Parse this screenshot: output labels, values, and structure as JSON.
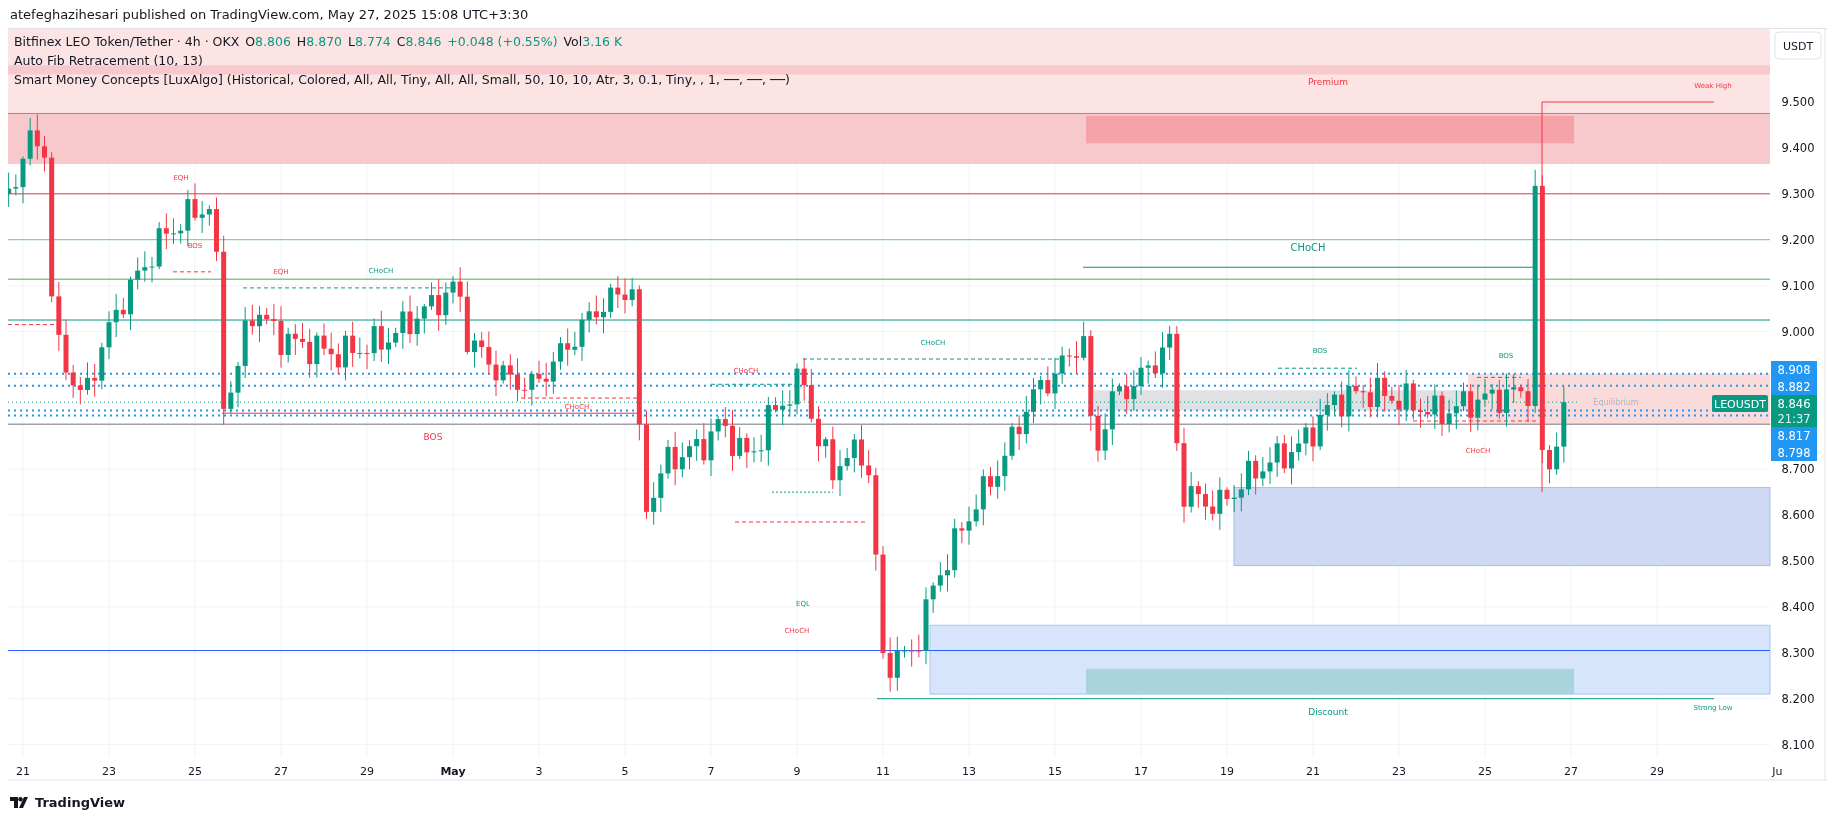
{
  "publisher": "atefeghazihesari published on TradingView.com, May 27, 2025 15:08 UTC+3:30",
  "legend": {
    "symbol": "Bitfinex LEO Token/Tether · 4h · OKX",
    "values": [
      {
        "key": "O",
        "value": "8.806"
      },
      {
        "key": "H",
        "value": "8.870"
      },
      {
        "key": "L",
        "value": "8.774"
      },
      {
        "key": "C",
        "value": "8.846"
      }
    ],
    "change": "+0.048 (+0.55%)",
    "volume_key": "Vol",
    "volume": "3.16 K",
    "indicators": [
      "Auto Fib Retracement (10, 13)",
      "Smart Money Concepts [LuxAlgo] (Historical, Colored, All, All, Tiny, All, All, Small, 50, 10, 10, Atr, 3, 0.1, Tiny, , 1, ──, ──, ──)"
    ]
  },
  "chart_labels": [
    {
      "text": "Premium",
      "kind": "bearish"
    },
    {
      "text": "Weak High",
      "kind": "bearish"
    },
    {
      "text": "EQH",
      "kind": "bearish"
    },
    {
      "text": "BOS",
      "kind": "bearish"
    },
    {
      "text": "EQH",
      "kind": "bearish"
    },
    {
      "text": "CHoCH",
      "kind": "bullish"
    },
    {
      "text": "CHoCH",
      "kind": "bullish"
    },
    {
      "text": "CHoCH",
      "kind": "bullish"
    },
    {
      "text": "BOS",
      "kind": "bullish"
    },
    {
      "text": "BOS",
      "kind": "bullish"
    },
    {
      "text": "CHoCH",
      "kind": "bearish"
    },
    {
      "text": "CHoCH",
      "kind": "bearish"
    },
    {
      "text": "Equilibrium",
      "kind": "neutral"
    },
    {
      "text": "BOS",
      "kind": "bearish"
    },
    {
      "text": "CHoCH",
      "kind": "bearish"
    },
    {
      "text": "EQL",
      "kind": "bullish"
    },
    {
      "text": "CHoCH",
      "kind": "bearish"
    },
    {
      "text": "Discount",
      "kind": "bullish"
    },
    {
      "text": "Strong Low",
      "kind": "bullish"
    }
  ],
  "symbol_tag": "LEOUSDT",
  "price_axis": {
    "unit_button": "USDT",
    "ticks": [
      "9.500",
      "9.400",
      "9.300",
      "9.200",
      "9.100",
      "9.000",
      "8.700",
      "8.600",
      "8.500",
      "8.400",
      "8.300",
      "8.200",
      "8.100"
    ],
    "tags": [
      {
        "text": "8.908",
        "kind": "level"
      },
      {
        "text": "8.882",
        "kind": "level"
      },
      {
        "text": "8.846",
        "kind": "last",
        "countdown": "21:37"
      },
      {
        "text": "8.817",
        "kind": "level"
      },
      {
        "text": "8.798",
        "kind": "level"
      }
    ]
  },
  "time_axis": [
    "21",
    "23",
    "25",
    "27",
    "29",
    "May",
    "3",
    "5",
    "7",
    "9",
    "11",
    "13",
    "15",
    "17",
    "19",
    "21",
    "23",
    "25",
    "27",
    "29",
    "Ju"
  ],
  "footer": {
    "brand": "TradingView"
  }
}
